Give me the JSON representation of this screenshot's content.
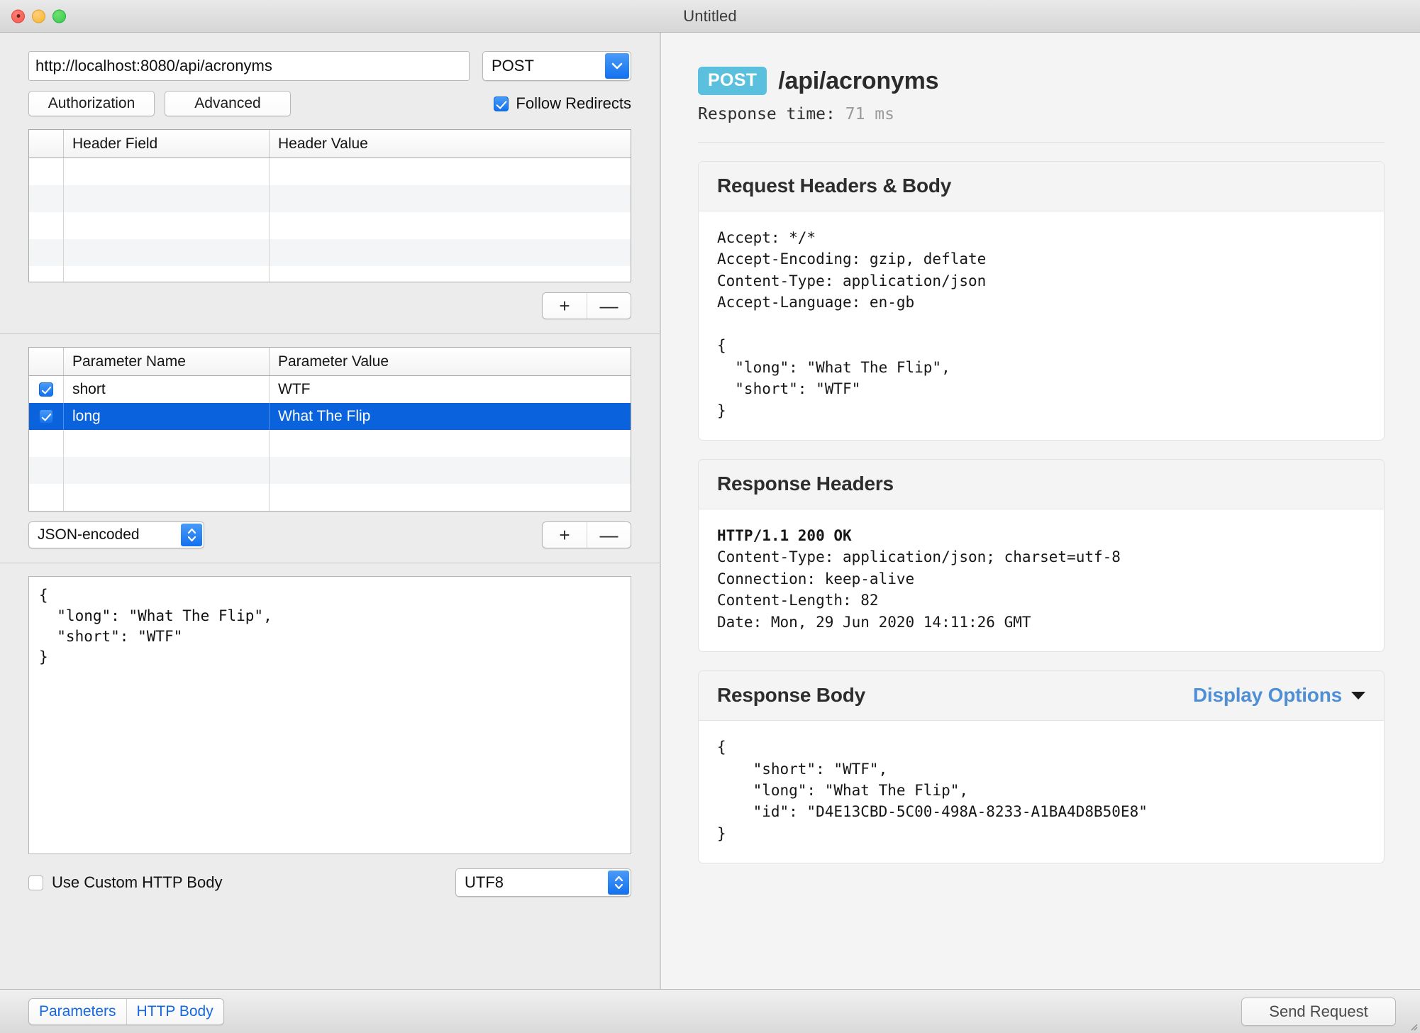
{
  "window": {
    "title": "Untitled",
    "traffic_lights": [
      "close",
      "minimize",
      "zoom"
    ]
  },
  "request": {
    "url_value": "http://localhost:8080/api/acronyms",
    "url_placeholder": "http://",
    "method": "POST",
    "buttons": {
      "authorization": "Authorization",
      "advanced": "Advanced"
    },
    "follow_redirects_label": "Follow Redirects",
    "follow_redirects_checked": true,
    "headers_table": {
      "columns": [
        "",
        "Header Field",
        "Header Value"
      ],
      "rows": [
        {
          "checked": null,
          "field": "",
          "value": ""
        },
        {
          "checked": null,
          "field": "",
          "value": ""
        },
        {
          "checked": null,
          "field": "",
          "value": ""
        },
        {
          "checked": null,
          "field": "",
          "value": ""
        }
      ],
      "add_label": "+",
      "remove_label": "—"
    },
    "params_table": {
      "columns": [
        "",
        "Parameter Name",
        "Parameter Value"
      ],
      "rows": [
        {
          "checked": true,
          "name": "short",
          "value": "WTF",
          "selected": false
        },
        {
          "checked": true,
          "name": "long",
          "value": "What The Flip",
          "selected": true
        },
        {
          "checked": null,
          "name": "",
          "value": "",
          "selected": false
        },
        {
          "checked": null,
          "name": "",
          "value": "",
          "selected": false
        },
        {
          "checked": null,
          "name": "",
          "value": "",
          "selected": false
        }
      ],
      "add_label": "+",
      "remove_label": "—"
    },
    "encoding": "JSON-encoded",
    "http_body": "{\n  \"long\": \"What The Flip\",\n  \"short\": \"WTF\"\n}",
    "use_custom_http_body_label": "Use Custom HTTP Body",
    "use_custom_http_body_checked": false,
    "charset": "UTF8"
  },
  "bottom": {
    "tabs": [
      {
        "label": "Parameters",
        "selected": true
      },
      {
        "label": "HTTP Body",
        "selected": false
      }
    ],
    "send_label": "Send Request"
  },
  "response": {
    "method_badge": "POST",
    "path": "/api/acronyms",
    "response_time_label": "Response time:",
    "response_time_value": "71 ms",
    "request_card": {
      "title": "Request Headers & Body",
      "content": "Accept: */*\nAccept-Encoding: gzip, deflate\nContent-Type: application/json\nAccept-Language: en-gb\n\n{\n  \"long\": \"What The Flip\",\n  \"short\": \"WTF\"\n}"
    },
    "headers_card": {
      "title": "Response Headers",
      "status_line": "HTTP/1.1 200 OK",
      "content": "\nContent-Type: application/json; charset=utf-8\nConnection: keep-alive\nContent-Length: 82\nDate: Mon, 29 Jun 2020 14:11:26 GMT"
    },
    "body_card": {
      "title": "Response Body",
      "display_options_label": "Display Options",
      "content": "{\n    \"short\": \"WTF\",\n    \"long\": \"What The Flip\",\n    \"id\": \"D4E13CBD-5C00-498A-8233-A1BA4D8B50E8\"\n}"
    }
  },
  "colors": {
    "accent_blue": "#1271ef",
    "selection_blue": "#0a63dd",
    "badge_cyan": "#5bc0de",
    "link_blue": "#4f8fd6",
    "tab_blue": "#1469e1"
  }
}
